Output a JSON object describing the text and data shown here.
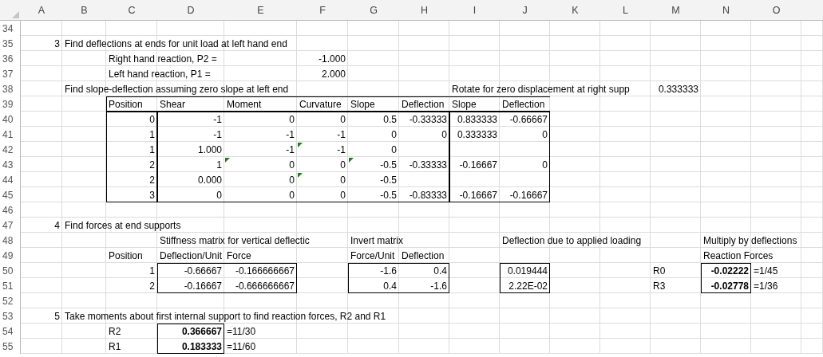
{
  "column_headers": [
    "A",
    "B",
    "C",
    "D",
    "E",
    "F",
    "G",
    "H",
    "I",
    "J",
    "K",
    "L",
    "M",
    "N",
    "O"
  ],
  "rows": [
    {
      "number": "34",
      "cells": {}
    },
    {
      "number": "35",
      "cells": {
        "A": {
          "text": "3",
          "kind": "number",
          "bold": false
        },
        "B": {
          "text": "Find deflections at ends for unit load at left hand end",
          "kind": "text",
          "bold": false
        }
      }
    },
    {
      "number": "36",
      "cells": {
        "C": {
          "text": "Right hand reaction, P2 =",
          "kind": "text",
          "bold": false
        },
        "F": {
          "text": "-1.000",
          "kind": "number",
          "bold": false
        }
      }
    },
    {
      "number": "37",
      "cells": {
        "C": {
          "text": "Left hand reaction, P1 =",
          "kind": "text",
          "bold": false
        },
        "F": {
          "text": "2.000",
          "kind": "number",
          "bold": false
        }
      }
    },
    {
      "number": "38",
      "cells": {
        "B": {
          "text": "Find slope-deflection assuming zero slope at left end",
          "kind": "text",
          "bold": false
        },
        "I": {
          "text": "Rotate for zero displacement at right supp",
          "kind": "text",
          "bold": false
        },
        "M": {
          "text": "0.333333",
          "kind": "number",
          "bold": false
        }
      }
    },
    {
      "number": "39",
      "cells": {
        "C": {
          "text": "Position",
          "kind": "text",
          "bold": false
        },
        "D": {
          "text": "Shear",
          "kind": "text",
          "bold": false
        },
        "E": {
          "text": "Moment",
          "kind": "text",
          "bold": false
        },
        "F": {
          "text": "Curvature",
          "kind": "text",
          "bold": false
        },
        "G": {
          "text": "Slope",
          "kind": "text",
          "bold": false
        },
        "H": {
          "text": "Deflection",
          "kind": "text",
          "bold": false
        },
        "I": {
          "text": "Slope",
          "kind": "text",
          "bold": false
        },
        "J": {
          "text": "Deflection",
          "kind": "text",
          "bold": false
        }
      }
    },
    {
      "number": "40",
      "cells": {
        "C": {
          "text": "0",
          "kind": "number",
          "bold": false
        },
        "D": {
          "text": "-1",
          "kind": "number",
          "bold": false
        },
        "E": {
          "text": "0",
          "kind": "number",
          "bold": false
        },
        "F": {
          "text": "0",
          "kind": "number",
          "bold": false
        },
        "G": {
          "text": "0.5",
          "kind": "number",
          "bold": false
        },
        "H": {
          "text": "-0.33333",
          "kind": "number",
          "bold": false
        },
        "I": {
          "text": "0.833333",
          "kind": "number",
          "bold": false
        },
        "J": {
          "text": "-0.66667",
          "kind": "number",
          "bold": false
        }
      }
    },
    {
      "number": "41",
      "cells": {
        "C": {
          "text": "1",
          "kind": "number",
          "bold": false
        },
        "D": {
          "text": "-1",
          "kind": "number",
          "bold": false
        },
        "E": {
          "text": "-1",
          "kind": "number",
          "bold": false
        },
        "F": {
          "text": "-1",
          "kind": "number",
          "bold": false
        },
        "G": {
          "text": "0",
          "kind": "number",
          "bold": false
        },
        "H": {
          "text": "0",
          "kind": "number",
          "bold": false
        },
        "I": {
          "text": "0.333333",
          "kind": "number",
          "bold": false
        },
        "J": {
          "text": "0",
          "kind": "number",
          "bold": false
        }
      }
    },
    {
      "number": "42",
      "cells": {
        "C": {
          "text": "1",
          "kind": "number",
          "bold": false
        },
        "D": {
          "text": "1.000",
          "kind": "number",
          "bold": false
        },
        "E": {
          "text": "-1",
          "kind": "number",
          "bold": false
        },
        "F": {
          "text": "-1",
          "kind": "number",
          "bold": false,
          "flagged": true
        },
        "G": {
          "text": "0",
          "kind": "number",
          "bold": false
        }
      }
    },
    {
      "number": "43",
      "cells": {
        "C": {
          "text": "2",
          "kind": "number",
          "bold": false
        },
        "D": {
          "text": "1",
          "kind": "number",
          "bold": false
        },
        "E": {
          "text": "0",
          "kind": "number",
          "bold": false,
          "flagged": true
        },
        "F": {
          "text": "0",
          "kind": "number",
          "bold": false
        },
        "G": {
          "text": "-0.5",
          "kind": "number",
          "bold": false,
          "flagged": true
        },
        "H": {
          "text": "-0.33333",
          "kind": "number",
          "bold": false
        },
        "I": {
          "text": "-0.16667",
          "kind": "number",
          "bold": false
        },
        "J": {
          "text": "0",
          "kind": "number",
          "bold": false
        }
      }
    },
    {
      "number": "44",
      "cells": {
        "C": {
          "text": "2",
          "kind": "number",
          "bold": false
        },
        "D": {
          "text": "0.000",
          "kind": "number",
          "bold": false
        },
        "E": {
          "text": "0",
          "kind": "number",
          "bold": false
        },
        "F": {
          "text": "0",
          "kind": "number",
          "bold": false,
          "flagged": true
        },
        "G": {
          "text": "-0.5",
          "kind": "number",
          "bold": false
        }
      }
    },
    {
      "number": "45",
      "cells": {
        "C": {
          "text": "3",
          "kind": "number",
          "bold": false
        },
        "D": {
          "text": "0",
          "kind": "number",
          "bold": false
        },
        "E": {
          "text": "0",
          "kind": "number",
          "bold": false
        },
        "F": {
          "text": "0",
          "kind": "number",
          "bold": false
        },
        "G": {
          "text": "-0.5",
          "kind": "number",
          "bold": false
        },
        "H": {
          "text": "-0.83333",
          "kind": "number",
          "bold": false
        },
        "I": {
          "text": "-0.16667",
          "kind": "number",
          "bold": false
        },
        "J": {
          "text": "-0.16667",
          "kind": "number",
          "bold": false
        }
      }
    },
    {
      "number": "46",
      "cells": {}
    },
    {
      "number": "47",
      "cells": {
        "A": {
          "text": "4",
          "kind": "number",
          "bold": false
        },
        "B": {
          "text": "Find forces at end supports",
          "kind": "text",
          "bold": false
        }
      }
    },
    {
      "number": "48",
      "cells": {
        "D": {
          "text": "Stiffness matrix for vertical deflectic",
          "kind": "text",
          "bold": false
        },
        "G": {
          "text": "Invert matrix",
          "kind": "text",
          "bold": false
        },
        "J": {
          "text": "Deflection due to applied loading",
          "kind": "text",
          "bold": false
        },
        "N": {
          "text": "Multiply by deflections",
          "kind": "text",
          "bold": false
        }
      }
    },
    {
      "number": "49",
      "cells": {
        "C": {
          "text": "Position",
          "kind": "text",
          "bold": false
        },
        "D": {
          "text": "Deflection/Unit",
          "kind": "text",
          "bold": false
        },
        "E": {
          "text": "Force",
          "kind": "text",
          "bold": false
        },
        "G": {
          "text": "Force/Unit",
          "kind": "text",
          "bold": false
        },
        "H": {
          "text": "Deflection",
          "kind": "text",
          "bold": false
        },
        "N": {
          "text": "Reaction Forces",
          "kind": "text",
          "bold": false
        }
      }
    },
    {
      "number": "50",
      "cells": {
        "C": {
          "text": "1",
          "kind": "number",
          "bold": false
        },
        "D": {
          "text": "-0.66667",
          "kind": "number",
          "bold": false
        },
        "E": {
          "text": "-0.166666667",
          "kind": "number",
          "bold": false
        },
        "G": {
          "text": "-1.6",
          "kind": "number",
          "bold": false
        },
        "H": {
          "text": "0.4",
          "kind": "number",
          "bold": false
        },
        "J": {
          "text": "0.019444",
          "kind": "number",
          "bold": false
        },
        "M": {
          "text": "R0",
          "kind": "text",
          "bold": false
        },
        "N": {
          "text": "-0.02222",
          "kind": "number",
          "bold": true
        },
        "O": {
          "text": "=1/45",
          "kind": "text",
          "bold": false
        }
      }
    },
    {
      "number": "51",
      "cells": {
        "C": {
          "text": "2",
          "kind": "number",
          "bold": false
        },
        "D": {
          "text": "-0.16667",
          "kind": "number",
          "bold": false
        },
        "E": {
          "text": "-0.666666667",
          "kind": "number",
          "bold": false
        },
        "G": {
          "text": "0.4",
          "kind": "number",
          "bold": false
        },
        "H": {
          "text": "-1.6",
          "kind": "number",
          "bold": false
        },
        "J": {
          "text": "2.22E-02",
          "kind": "number",
          "bold": false
        },
        "M": {
          "text": "R3",
          "kind": "text",
          "bold": false
        },
        "N": {
          "text": "-0.02778",
          "kind": "number",
          "bold": true
        },
        "O": {
          "text": "=1/36",
          "kind": "text",
          "bold": false
        }
      }
    },
    {
      "number": "52",
      "cells": {}
    },
    {
      "number": "53",
      "cells": {
        "A": {
          "text": "5",
          "kind": "number",
          "bold": false
        },
        "B": {
          "text": "Take moments about first internal support to find reaction forces, R2 and R1",
          "kind": "text",
          "bold": false
        }
      }
    },
    {
      "number": "54",
      "cells": {
        "C": {
          "text": "R2",
          "kind": "text",
          "bold": false
        },
        "D": {
          "text": "0.366667",
          "kind": "number",
          "bold": true
        },
        "E": {
          "text": "=11/30",
          "kind": "text",
          "bold": false
        }
      }
    },
    {
      "number": "55",
      "cells": {
        "C": {
          "text": "R1",
          "kind": "text",
          "bold": false
        },
        "D": {
          "text": "0.183333",
          "kind": "number",
          "bold": true
        },
        "E": {
          "text": "=11/60",
          "kind": "text",
          "bold": false
        }
      }
    }
  ]
}
